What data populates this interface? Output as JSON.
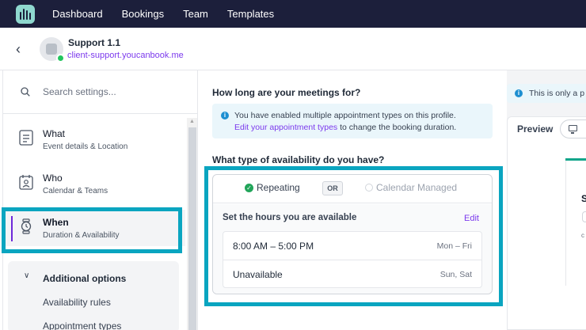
{
  "nav": {
    "items": [
      "Dashboard",
      "Bookings",
      "Team",
      "Templates"
    ]
  },
  "profile": {
    "name": "Support 1.1",
    "url": "client-support.youcanbook.me"
  },
  "sidebar": {
    "search_placeholder": "Search settings...",
    "items": [
      {
        "title": "What",
        "subtitle": "Event details & Location",
        "icon": "document-icon"
      },
      {
        "title": "Who",
        "subtitle": "Calendar & Teams",
        "icon": "calendar-person-icon"
      },
      {
        "title": "When",
        "subtitle": "Duration & Availability",
        "icon": "watch-icon",
        "active": true
      }
    ],
    "additional": {
      "label": "Additional options",
      "items": [
        "Availability rules",
        "Appointment types"
      ]
    }
  },
  "main": {
    "duration_question": "How long are your meetings for?",
    "info": {
      "line1": "You have enabled multiple appointment types on this profile.",
      "link": "Edit your appointment types",
      "line2_rest": " to change the booking duration."
    },
    "availability_question": "What type of availability do you have?",
    "tabs": {
      "repeating": "Repeating",
      "or": "OR",
      "calendar_managed": "Calendar Managed"
    },
    "hours_heading": "Set the hours you are available",
    "edit_label": "Edit",
    "rows": [
      {
        "hours": "8:00 AM – 5:00 PM",
        "days": "Mon – Fri"
      },
      {
        "hours": "Unavailable",
        "days": "Sun, Sat"
      }
    ]
  },
  "preview": {
    "info_text": "This is only a p",
    "label": "Preview",
    "title_initial": "S",
    "small_text": "c"
  },
  "colors": {
    "topnav": "#1c1f3b",
    "accent": "#7c3aed",
    "highlight": "#0aa5c0",
    "success": "#22a55a"
  }
}
